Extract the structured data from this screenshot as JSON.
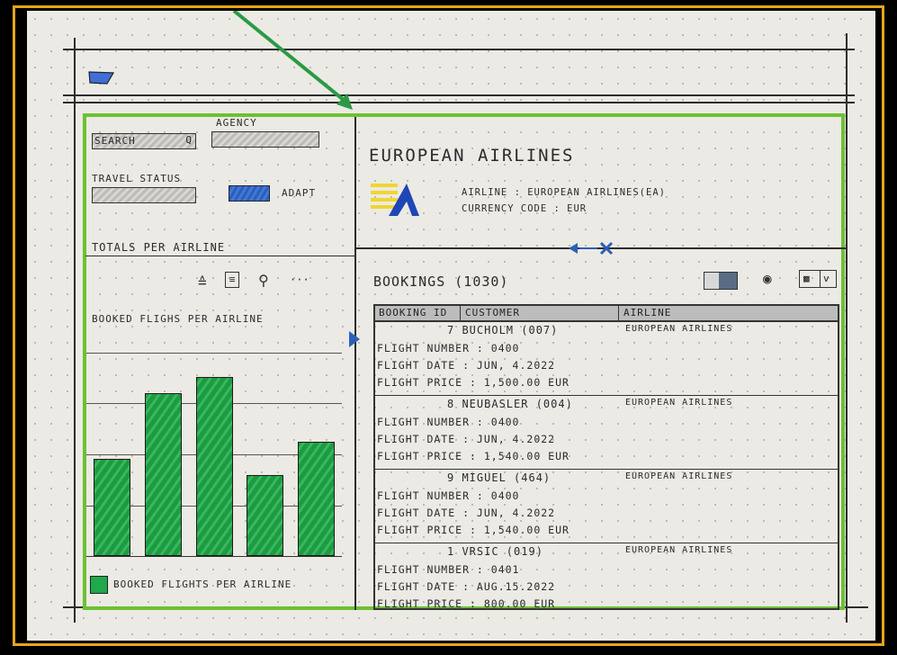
{
  "header": {
    "logo_icon": "logo-icon"
  },
  "filters": {
    "search_label": "SEARCH",
    "agency_label": "AGENCY",
    "travel_status_label": "TRAVEL STATUS",
    "adapt_label": "ADAPT"
  },
  "chart_panel": {
    "title": "TOTALS PER AIRLINE",
    "chart_title": "BOOKED FLIGHS PER AIRLINE",
    "legend": "BOOKED FLIGHTS PER AIRLINE"
  },
  "chart_data": {
    "type": "bar",
    "title": "BOOKED FLIGHS PER AIRLINE",
    "series": [
      {
        "name": "BOOKED FLIGHTS PER AIRLINE",
        "values": [
          120,
          200,
          220,
          100,
          140
        ]
      }
    ],
    "categories": [
      "",
      "",
      "",
      "",
      ""
    ],
    "ylim": [
      0,
      250
    ],
    "grid": true
  },
  "airline": {
    "title": "EUROPEAN AIRLINES",
    "airline_line": "AIRLINE : EUROPEAN AIRLINES(EA)",
    "currency_line": "CURRENCY CODE : EUR"
  },
  "bookings": {
    "title": "BOOKINGS (1030)",
    "columns": [
      "BOOKING ID",
      "CUSTOMER",
      "AIRLINE"
    ],
    "rows": [
      {
        "customer": "7  BUCHOLM  (007)",
        "airline": "EUROPEAN  AIRLINES",
        "flight_number": "FLIGHT NUMBER : 0400",
        "flight_date": "FLIGHT DATE : JUN, 4.2022",
        "flight_price": "FLIGHT PRICE : 1,500.00 EUR"
      },
      {
        "customer": "8  NEUBASLER  (004)",
        "airline": "EUROPEAN  AIRLINES",
        "flight_number": "FLIGHT NUMBER : 0400",
        "flight_date": "FLIGHT DATE : JUN, 4.2022",
        "flight_price": "FLIGHT PRICE : 1,540.00 EUR"
      },
      {
        "customer": "9  MIGUEL    (464)",
        "airline": "EUROPEAN  AIRLINES",
        "flight_number": "FLIGHT NUMBER : 0400",
        "flight_date": "FLIGHT DATE : JUN, 4.2022",
        "flight_price": "FLIGHT PRICE : 1,540.00 EUR"
      },
      {
        "customer": "1  VRSIC  (019)",
        "airline": "EUROPEAN  AIRLINES",
        "flight_number": "FLIGHT NUMBER : 0401",
        "flight_date": "FLIGHT DATE : AUG.15.2022",
        "flight_price": "FLIGHT PRICE : 800.00 EUR"
      }
    ]
  },
  "colors": {
    "accent_green": "#6cc133",
    "frame_orange": "#e7a51a",
    "bar_green": "#1fa94a",
    "button_blue": "#3f78d4"
  }
}
